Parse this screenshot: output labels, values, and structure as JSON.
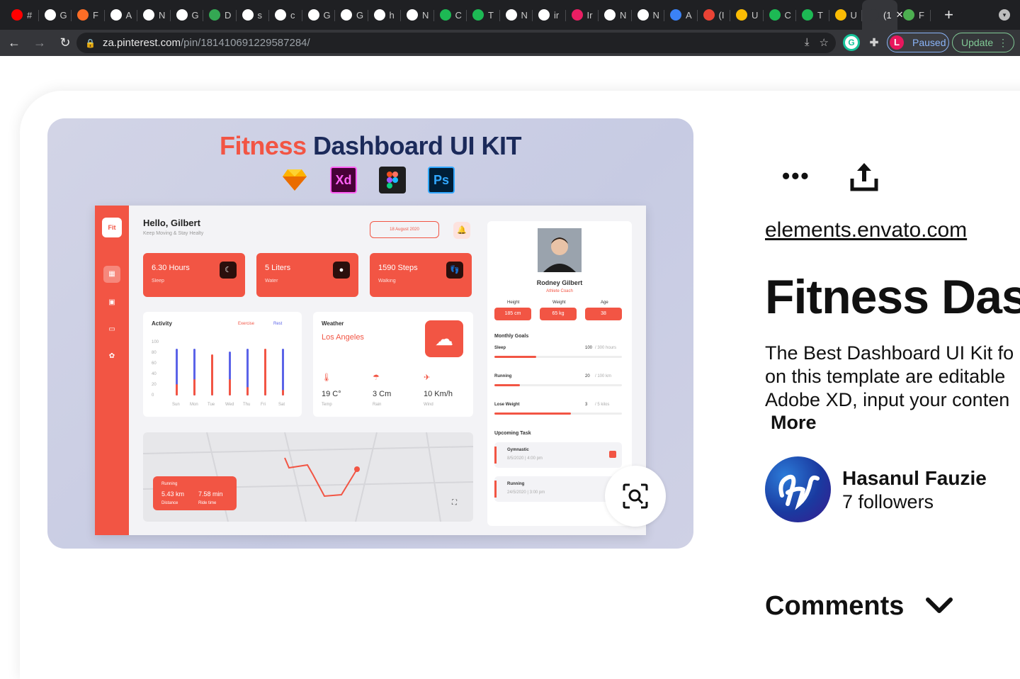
{
  "browser": {
    "tabs": [
      {
        "label": "#",
        "color": "#ff0000",
        "icon": "youtube-icon"
      },
      {
        "label": "G",
        "color": "#ffffff",
        "icon": "google-icon"
      },
      {
        "label": "F",
        "color": "#fc6d26",
        "icon": "gitlab-icon"
      },
      {
        "label": "A",
        "color": "#ffffff",
        "icon": "a-icon"
      },
      {
        "label": "N",
        "color": "#ffffff",
        "icon": "openai-icon"
      },
      {
        "label": "G",
        "color": "#ffffff",
        "icon": "google-icon"
      },
      {
        "label": "D",
        "color": "#34a853",
        "icon": "leaf-icon"
      },
      {
        "label": "s",
        "color": "#ffffff",
        "icon": "google-icon"
      },
      {
        "label": "c",
        "color": "#ffffff",
        "icon": "google-icon"
      },
      {
        "label": "G",
        "color": "#ffffff",
        "icon": "google-icon"
      },
      {
        "label": "G",
        "color": "#ffffff",
        "icon": "google-icon"
      },
      {
        "label": "h",
        "color": "#ffffff",
        "icon": "google-icon"
      },
      {
        "label": "N",
        "color": "#ffffff",
        "icon": "openai-icon"
      },
      {
        "label": "C",
        "color": "#1db954",
        "icon": "w-icon"
      },
      {
        "label": "T",
        "color": "#1db954",
        "icon": "w-icon"
      },
      {
        "label": "N",
        "color": "#ffffff",
        "icon": "openai-icon"
      },
      {
        "label": "ir",
        "color": "#ffffff",
        "icon": "google-icon"
      },
      {
        "label": "Ir",
        "color": "#e91e63",
        "icon": "star-icon"
      },
      {
        "label": "N",
        "color": "#ffffff",
        "icon": "openai-icon"
      },
      {
        "label": "N",
        "color": "#ffffff",
        "icon": "openai-icon"
      },
      {
        "label": "A",
        "color": "#3b82f6",
        "icon": "mds-icon"
      },
      {
        "label": "(I",
        "color": "#ea4335",
        "icon": "gmail-icon"
      },
      {
        "label": "U",
        "color": "#fbbc04",
        "icon": "oi-icon"
      },
      {
        "label": "C",
        "color": "#1db954",
        "icon": "w-icon"
      },
      {
        "label": "T",
        "color": "#1db954",
        "icon": "w-icon"
      },
      {
        "label": "U",
        "color": "#fbbc04",
        "icon": "oi-icon"
      },
      {
        "label": "(1",
        "color": "#35363a",
        "icon": "pinterest-icon",
        "active": true
      },
      {
        "label": "F",
        "color": "#4caf50",
        "icon": "leaf-icon"
      }
    ],
    "url_host": "za.pinterest.com",
    "url_path": "/pin/181410691229587284/",
    "profile_label": "Paused",
    "profile_initial": "L",
    "update_label": "Update"
  },
  "pin_image": {
    "title_red": "Fitness",
    "title_navy": "Dashboard UI KIT",
    "tools": [
      "Sketch",
      "Xd",
      "Figma",
      "Ps"
    ],
    "dashboard": {
      "logo": "Fit",
      "greeting": "Hello, Gilbert",
      "greeting_sub": "Keep Moving & Stay Healty",
      "date": "18 August 2020",
      "stats": [
        {
          "value": "6.30 Hours",
          "label": "Sleep"
        },
        {
          "value": "5 Liters",
          "label": "Water"
        },
        {
          "value": "1590 Steps",
          "label": "Walking"
        }
      ],
      "activity_title": "Activity",
      "activity_legend": [
        "Exercise",
        "Rest"
      ],
      "activity_days": [
        "Sun",
        "Mon",
        "Tue",
        "Wed",
        "Thu",
        "Fri",
        "Sat"
      ],
      "activity_yticks": [
        "100",
        "80",
        "60",
        "40",
        "20",
        "0"
      ],
      "weather_title": "Weather",
      "weather_city": "Los Angeles",
      "weather_stats": [
        {
          "value": "19 C°",
          "label": "Temp"
        },
        {
          "value": "3 Cm",
          "label": "Rain"
        },
        {
          "value": "10 Km/h",
          "label": "Wind"
        }
      ],
      "run_label": "Running",
      "run_distance": "5.43 km",
      "run_time": "7.58 min",
      "run_distance_label": "Distance",
      "run_time_label": "Ride time",
      "profile_name": "Rodney Gilbert",
      "profile_role": "Athlete Coach",
      "profile_headers": [
        "Height",
        "Weight",
        "Age"
      ],
      "profile_values": [
        "185 cm",
        "65 kg",
        "38"
      ],
      "goals_title": "Monthly Goals",
      "goals": [
        {
          "name": "Sleep",
          "value": "100",
          "total": "/ 300 hours",
          "progress": 0.33
        },
        {
          "name": "Running",
          "value": "20",
          "total": "/ 100 km",
          "progress": 0.2
        },
        {
          "name": "Lose Weight",
          "value": "3",
          "total": "/ 5 kilos",
          "progress": 0.6
        }
      ],
      "tasks_title": "Upcoming Task",
      "tasks": [
        {
          "name": "Gymnastic",
          "date": "8/5/2020 | 4:00 pm"
        },
        {
          "name": "Running",
          "date": "24/5/2020 | 3:00 pm"
        }
      ]
    }
  },
  "pin": {
    "source": "elements.envato.com",
    "title": "Fitness Das",
    "description_lines": [
      "The Best Dashboard UI Kit fo",
      "on this template are editable",
      "Adobe XD, input your conten"
    ],
    "more_label": "More",
    "creator_name": "Hasanul Fauzie",
    "creator_followers": "7 followers",
    "comments_label": "Comments"
  }
}
